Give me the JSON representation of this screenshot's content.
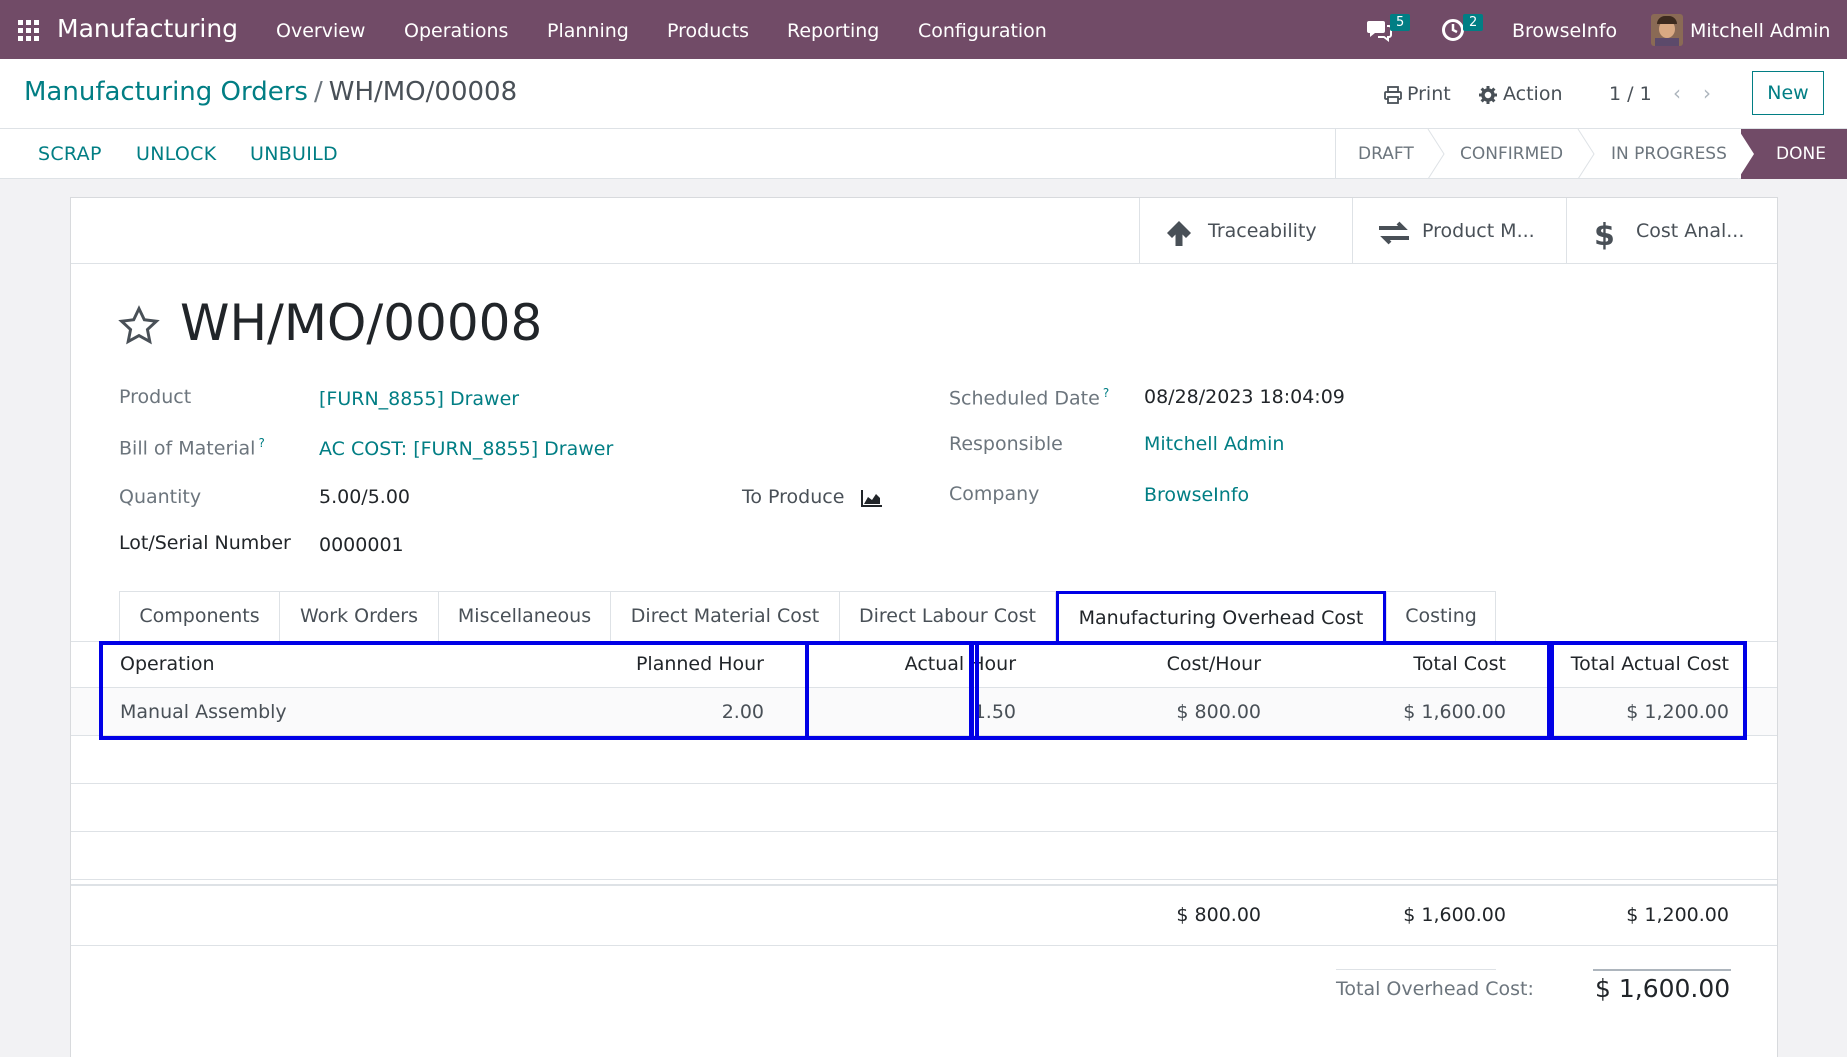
{
  "navbar": {
    "app_name": "Manufacturing",
    "menu": [
      "Overview",
      "Operations",
      "Planning",
      "Products",
      "Reporting",
      "Configuration"
    ],
    "messages_count": "5",
    "activities_count": "2",
    "company": "BrowseInfo",
    "user": "Mitchell Admin"
  },
  "breadcrumb": {
    "parent": "Manufacturing Orders",
    "separator": "/",
    "current": "WH/MO/00008"
  },
  "control": {
    "print": "Print",
    "action": "Action",
    "pager": "1 / 1",
    "new": "New"
  },
  "statusbar": {
    "buttons": [
      "SCRAP",
      "UNLOCK",
      "UNBUILD"
    ],
    "stages": [
      "DRAFT",
      "CONFIRMED",
      "IN PROGRESS",
      "DONE"
    ],
    "active_stage": "DONE"
  },
  "smart_buttons": {
    "traceability": "Traceability",
    "product_moves": "Product M...",
    "cost_analysis": "Cost Anal..."
  },
  "record": {
    "title": "WH/MO/00008",
    "left_fields": {
      "product_label": "Product",
      "product_value": "[FURN_8855] Drawer",
      "bom_label": "Bill of Material",
      "bom_value": "AC COST: [FURN_8855] Drawer",
      "quantity_label": "Quantity",
      "quantity_value": "5.00/5.00",
      "to_produce": "To Produce",
      "lot_label": "Lot/Serial Number",
      "lot_value": "0000001"
    },
    "right_fields": {
      "scheduled_label": "Scheduled Date",
      "scheduled_value": "08/28/2023 18:04:09",
      "responsible_label": "Responsible",
      "responsible_value": "Mitchell Admin",
      "company_label": "Company",
      "company_value": "BrowseInfo"
    },
    "help_mark": "?"
  },
  "tabs": [
    "Components",
    "Work Orders",
    "Miscellaneous",
    "Direct Material Cost",
    "Direct Labour Cost",
    "Manufacturing Overhead Cost",
    "Costing"
  ],
  "active_tab": "Manufacturing Overhead Cost",
  "table": {
    "headers": {
      "operation": "Operation",
      "planned_hour": "Planned Hour",
      "actual_hour": "Actual Hour",
      "cost_hour": "Cost/Hour",
      "total_cost": "Total Cost",
      "total_actual_cost": "Total Actual Cost"
    },
    "rows": [
      {
        "operation": "Manual Assembly",
        "planned_hour": "2.00",
        "actual_hour": "1.50",
        "cost_hour": "$ 800.00",
        "total_cost": "$ 1,600.00",
        "total_actual_cost": "$ 1,200.00"
      }
    ],
    "footer": {
      "cost_hour": "$ 800.00",
      "total_cost": "$ 1,600.00",
      "total_actual_cost": "$ 1,200.00"
    }
  },
  "totals": {
    "label": "Total Overhead Cost:",
    "value": "$ 1,600.00"
  },
  "colors": {
    "brand": "#714b67",
    "link": "#017e84",
    "highlight": "#0000e6"
  }
}
